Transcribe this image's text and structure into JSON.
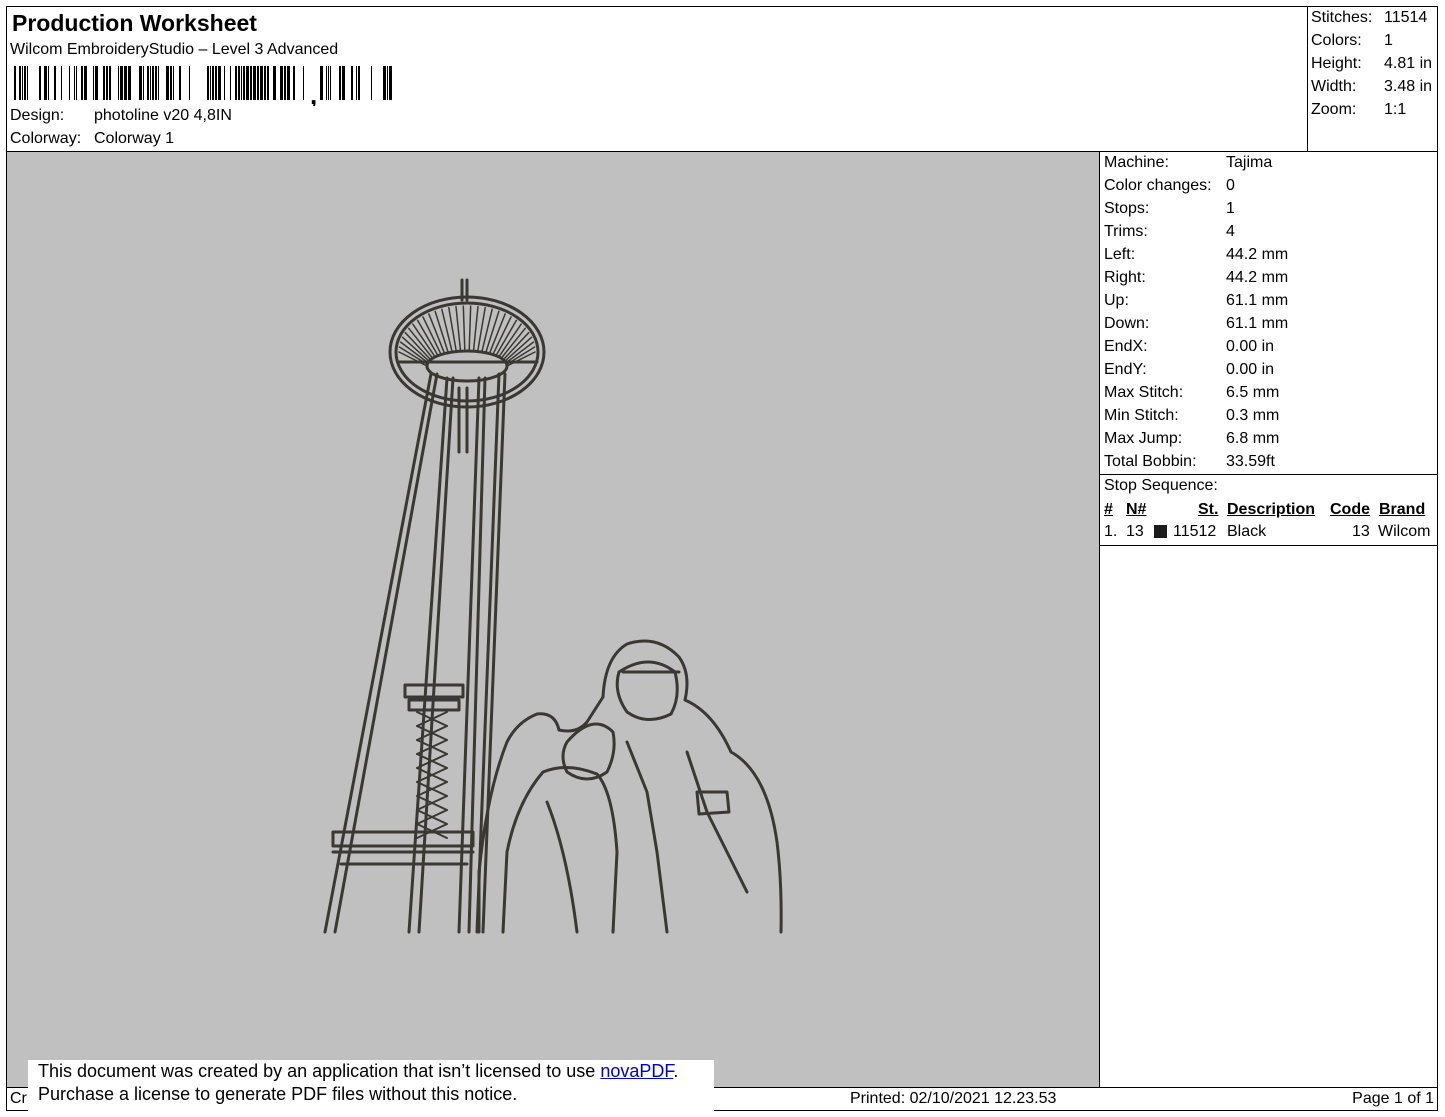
{
  "header": {
    "title": "Production Worksheet",
    "subtitle": "Wilcom EmbroideryStudio – Level 3 Advanced",
    "design_label": "Design:",
    "design_value": "photoline v20 4,8IN",
    "colorway_label": "Colorway:",
    "colorway_value": "Colorway 1"
  },
  "stats": [
    {
      "label": "Stitches:",
      "value": "11514"
    },
    {
      "label": "Colors:",
      "value": "1"
    },
    {
      "label": "Height:",
      "value": "4.81 in"
    },
    {
      "label": "Width:",
      "value": "3.48 in"
    },
    {
      "label": "Zoom:",
      "value": "1:1"
    }
  ],
  "info": [
    {
      "label": "Machine:",
      "value": "Tajima"
    },
    {
      "label": "Color changes:",
      "value": "0"
    },
    {
      "label": "Stops:",
      "value": "1"
    },
    {
      "label": "Trims:",
      "value": "4"
    },
    {
      "label": "Left:",
      "value": "44.2 mm"
    },
    {
      "label": "Right:",
      "value": "44.2 mm"
    },
    {
      "label": "Up:",
      "value": "61.1 mm"
    },
    {
      "label": "Down:",
      "value": "61.1 mm"
    },
    {
      "label": "EndX:",
      "value": "0.00 in"
    },
    {
      "label": "EndY:",
      "value": "0.00 in"
    },
    {
      "label": "Max Stitch:",
      "value": "6.5 mm"
    },
    {
      "label": "Min Stitch:",
      "value": "0.3 mm"
    },
    {
      "label": "Max Jump:",
      "value": "6.8 mm"
    },
    {
      "label": "Total Bobbin:",
      "value": "33.59ft"
    }
  ],
  "stop_sequence": {
    "label": "Stop Sequence:",
    "headers": {
      "num": "#",
      "needle": "N#",
      "stitches": "St.",
      "description": "Description",
      "code": "Code",
      "brand": "Brand"
    },
    "rows": [
      {
        "num": "1.",
        "needle": "13",
        "stitches": "11512",
        "description": "Black",
        "code": "13",
        "brand": "Wilcom",
        "color": "#1b1b1b"
      }
    ]
  },
  "footer": {
    "cr": "Cr",
    "printed": "Printed: 02/10/2021 12.23.53",
    "page": "Page 1 of 1"
  },
  "notice": {
    "line1_pre": "This document was created by an application that isn’t licensed to use ",
    "link": "novaPDF",
    "line1_post": ".",
    "line2": "Purchase a license to generate PDF files without this notice."
  },
  "colors": {
    "preview_bg": "#c0c0c0",
    "thread": "#3a3833"
  }
}
